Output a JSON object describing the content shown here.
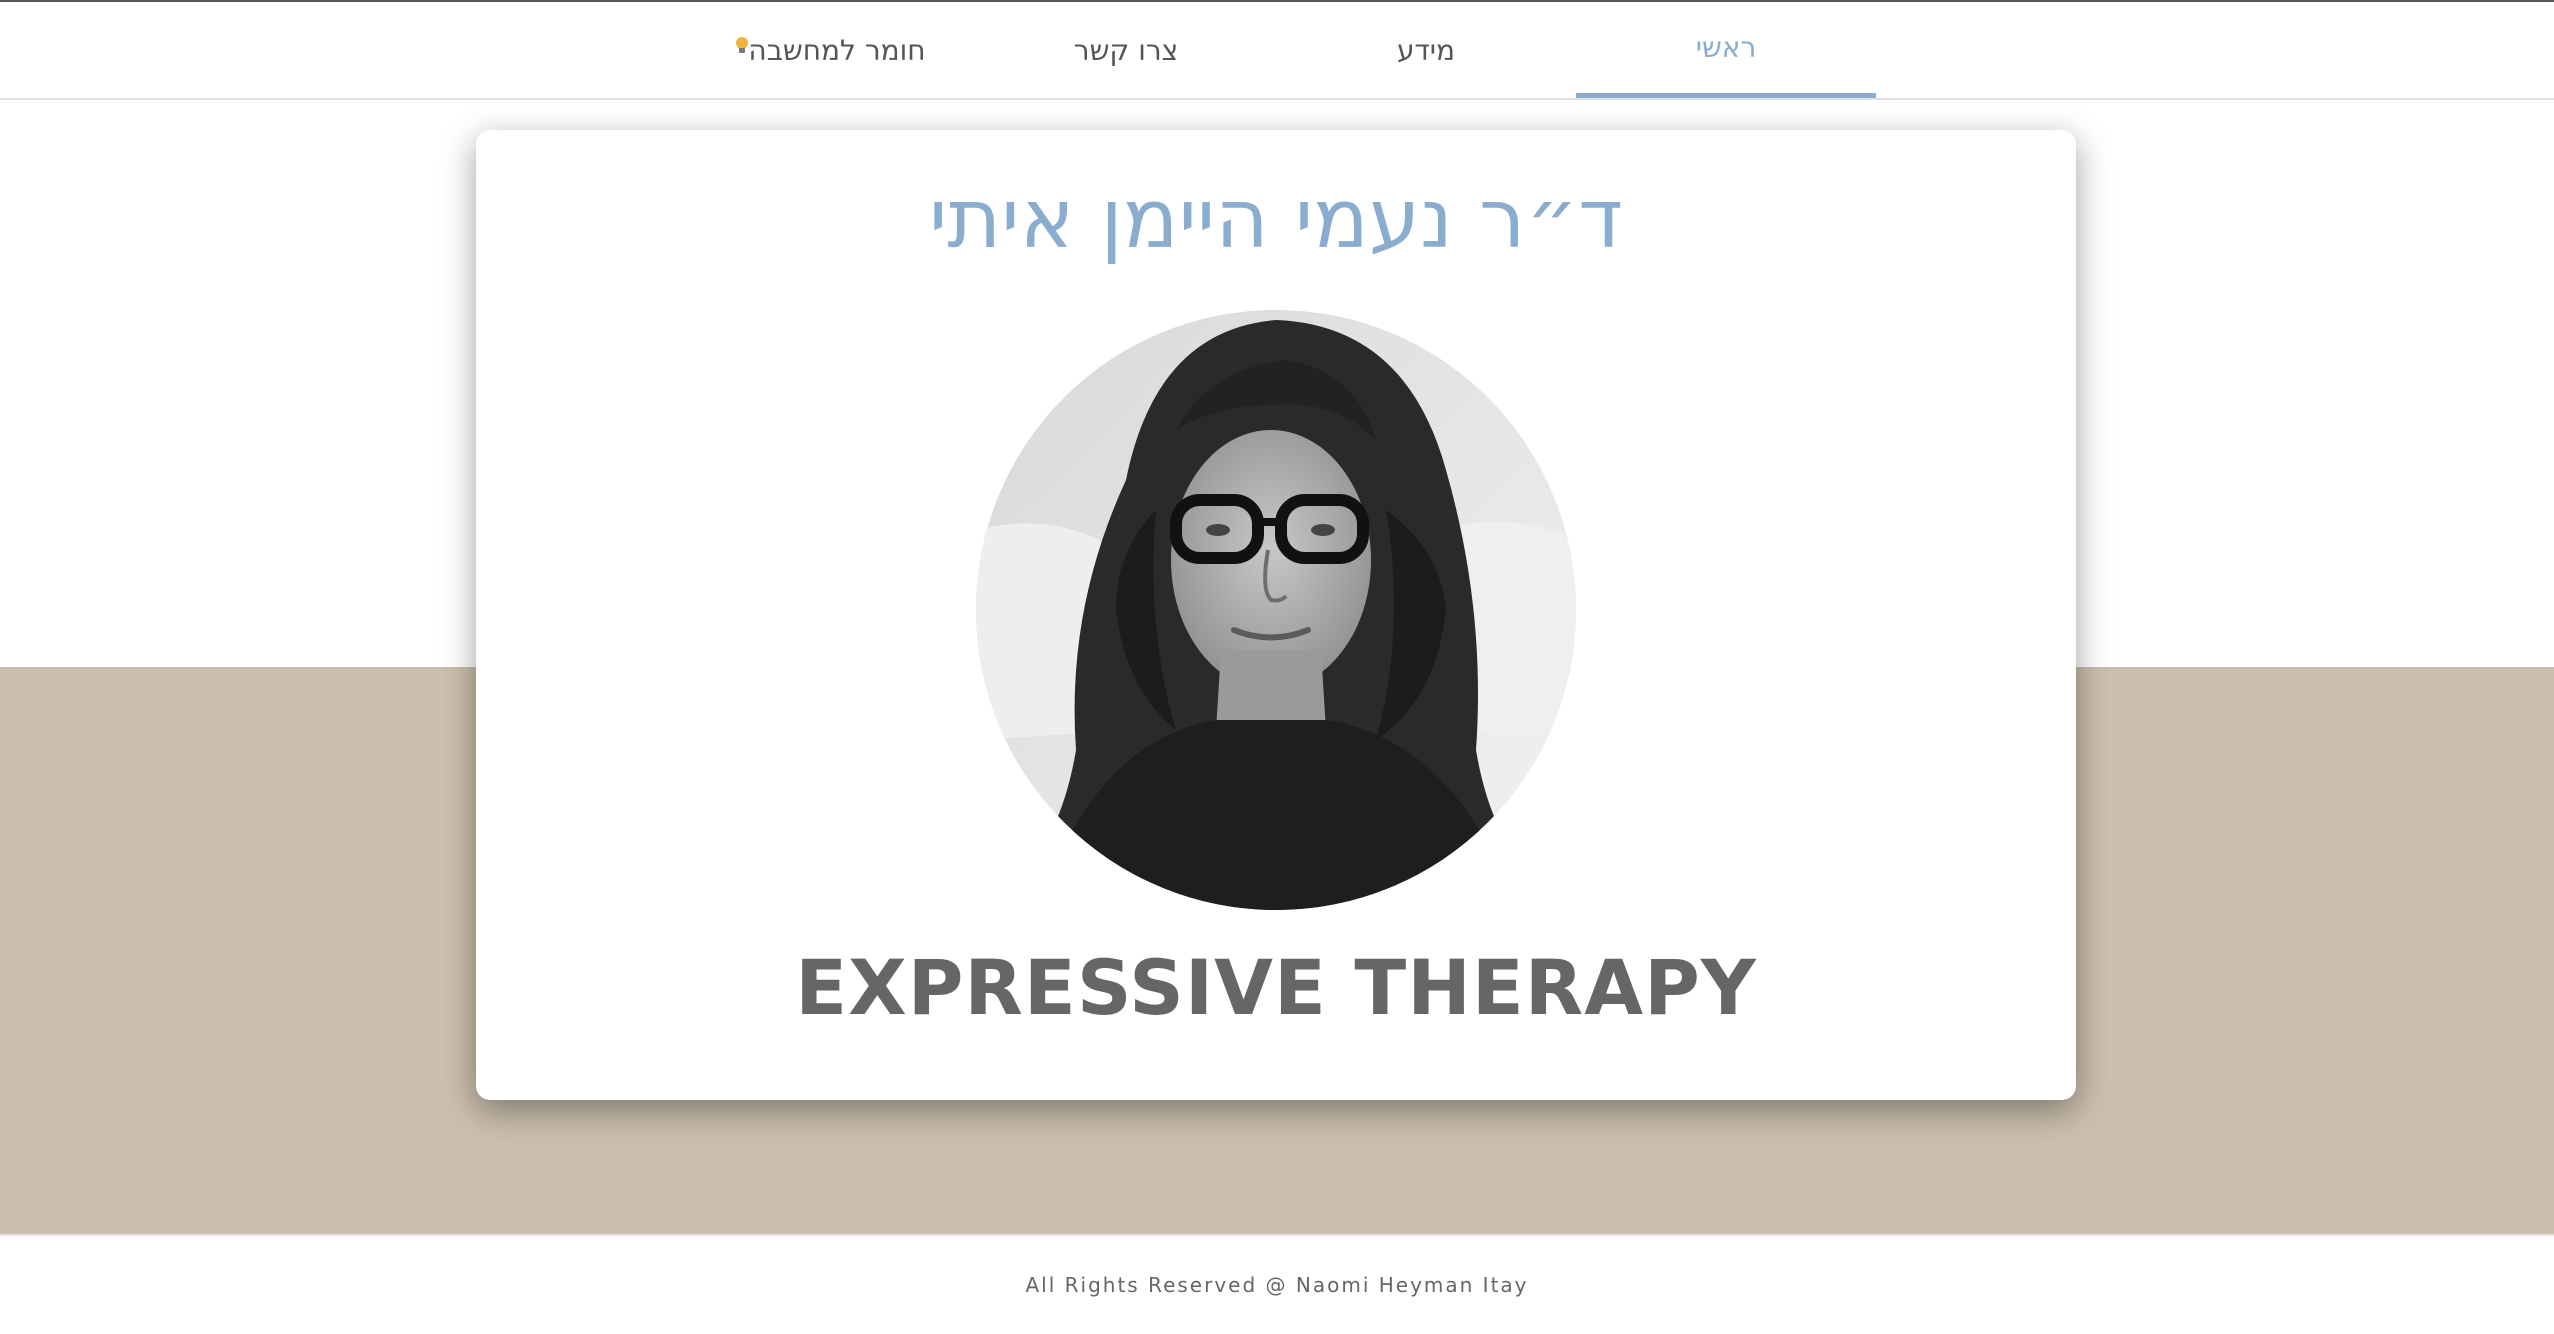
{
  "nav": {
    "items": [
      {
        "label": "ראשי"
      },
      {
        "label": "מידע"
      },
      {
        "label": "צרו קשר"
      },
      {
        "label": "חומר למחשבה"
      }
    ],
    "active_index": 0,
    "food_icon": "lightbulb-icon"
  },
  "hero": {
    "title": "ד״ר נעמי היימן איתי",
    "subtitle": "EXPRESSIVE THERAPY"
  },
  "footer": {
    "text": "All Rights Reserved @ Naomi Heyman Itay"
  },
  "colors": {
    "accent": "#8aacce",
    "band": "#cbbfad",
    "text": "#666666",
    "bulb": "#f0b43a"
  }
}
